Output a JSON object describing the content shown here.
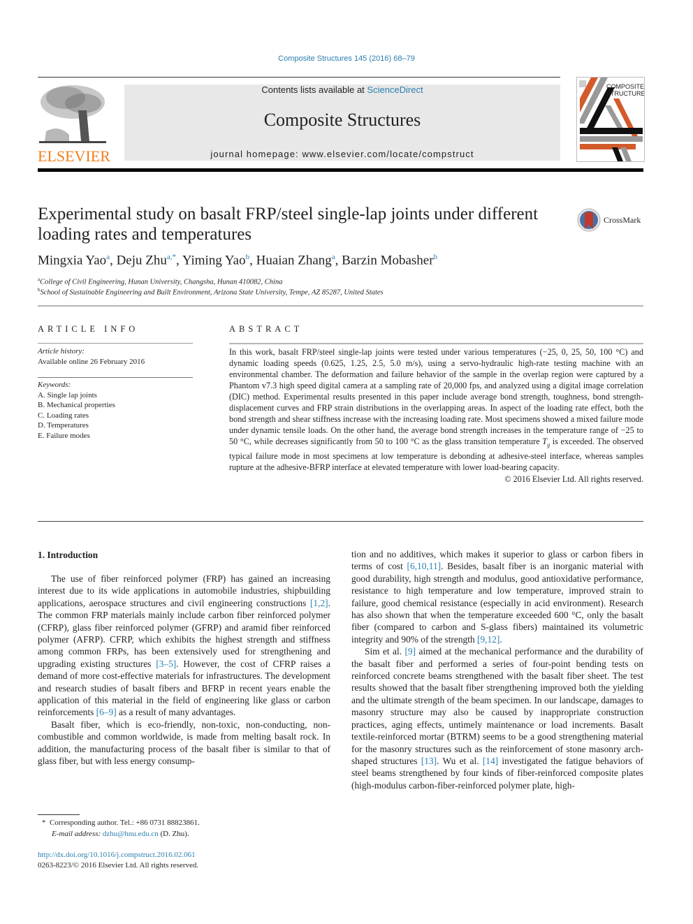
{
  "header": {
    "citation": "Composite Structures 145 (2016) 68–79",
    "contents_prefix": "Contents lists available at ",
    "contents_link": "ScienceDirect",
    "journal_name": "Composite Structures",
    "homepage": "journal homepage: www.elsevier.com/locate/compstruct",
    "publisher_logo_text": "ELSEVIER",
    "cover_text_line1": "COMPOSITE",
    "cover_text_line2": "STRUCTURES",
    "crossmark_label": "CrossMark"
  },
  "colors": {
    "link": "#2a7fb0",
    "elsevier_orange": "#f07f1c",
    "cover_orange": "#d35a2a",
    "crossmark_red": "#c0392b"
  },
  "article": {
    "title_line1": "Experimental study on basalt FRP/steel single-lap joints under different",
    "title_line2": "loading rates and temperatures",
    "authors": [
      {
        "name": "Mingxia Yao",
        "sup": "a"
      },
      {
        "name": "Deju Zhu",
        "sup": "a,*"
      },
      {
        "name": "Yiming Yao",
        "sup": "b"
      },
      {
        "name": "Huaian Zhang",
        "sup": "a"
      },
      {
        "name": "Barzin Mobasher",
        "sup": "b"
      }
    ],
    "affiliations": [
      {
        "sup": "a",
        "text": "College of Civil Engineering, Hunan University, Changsha, Hunan 410082, China"
      },
      {
        "sup": "b",
        "text": "School of Sustainable Engineering and Built Environment, Arizona State University, Tempe, AZ 85287, United States"
      }
    ]
  },
  "article_info": {
    "heading": "ARTICLE INFO",
    "history_label": "Article history:",
    "history_value": "Available online 26 February 2016",
    "keywords_label": "Keywords:",
    "keywords": [
      "A. Single lap joints",
      "B. Mechanical properties",
      "C. Loading rates",
      "D. Temperatures",
      "E. Failure modes"
    ]
  },
  "abstract": {
    "heading": "ABSTRACT",
    "text_part1": "In this work, basalt FRP/steel single-lap joints were tested under various temperatures (−25, 0, 25, 50, 100 °C) and dynamic loading speeds (0.625, 1.25, 2.5, 5.0 m/s), using a servo-hydraulic high-rate testing machine with an environmental chamber. The deformation and failure behavior of the sample in the overlap region were captured by a Phantom v7.3 high speed digital camera at a sampling rate of 20,000 fps, and analyzed using a digital image correlation (DIC) method. Experimental results presented in this paper include average bond strength, toughness, bond strength-displacement curves and FRP strain distributions in the overlapping areas. In aspect of the loading rate effect, both the bond strength and shear stiffness increase with the increasing loading rate. Most specimens showed a mixed failure mode under dynamic tensile loads. On the other hand, the average bond strength increases in the temperature range of −25 to 50 °C, while decreases significantly from 50 to 100 °C as the glass transition temperature ",
    "tg_symbol": "T",
    "tg_sub": "g",
    "text_part2": " is exceeded. The observed typical failure mode in most specimens at low temperature is debonding at adhesive-steel interface, whereas samples rupture at the adhesive-BFRP interface at elevated temperature with lower load-bearing capacity.",
    "copyright": "© 2016 Elsevier Ltd. All rights reserved."
  },
  "introduction": {
    "heading": "1. Introduction",
    "p1": [
      {
        "t": "The use of fiber reinforced polymer (FRP) has gained an increasing interest due to its wide applications in automobile industries, shipbuilding applications, aerospace structures and civil engineering constructions "
      },
      {
        "ref": "[1,2]"
      },
      {
        "t": ". The common FRP materials mainly include carbon fiber reinforced polymer (CFRP), glass fiber reinforced polymer (GFRP) and aramid fiber reinforced polymer (AFRP). CFRP, which exhibits the highest strength and stiffness among common FRPs, has been extensively used for strengthening and upgrading existing structures "
      },
      {
        "ref": "[3–5]"
      },
      {
        "t": ". However, the cost of CFRP raises a demand of more cost-effective materials for infrastructures. The development and research studies of basalt fibers and BFRP in recent years enable the application of this material in the field of engineering like glass or carbon reinforcements "
      },
      {
        "ref": "[6–9]"
      },
      {
        "t": " as a result of many advantages."
      }
    ],
    "p2": [
      {
        "t": "Basalt fiber, which is eco-friendly, non-toxic, non-conducting, non-combustible and common worldwide, is made from melting basalt rock. In addition, the manufacturing process of the basalt fiber is similar to that of glass fiber, but with less energy consump-"
      }
    ],
    "col2_p2_cont": [
      {
        "t": "tion and no additives, which makes it superior to glass or carbon fibers in terms of cost "
      },
      {
        "ref": "[6,10,11]"
      },
      {
        "t": ". Besides, basalt fiber is an inorganic material with good durability, high strength and modulus, good antioxidative performance, resistance to high temperature and low temperature, improved strain to failure, good chemical resistance (especially in acid environment). Research has also shown that when the temperature exceeded 600 °C, only the basalt fiber (compared to carbon and S-glass fibers) maintained its volumetric integrity and 90% of the strength "
      },
      {
        "ref": "[9,12]"
      },
      {
        "t": "."
      }
    ],
    "p3": [
      {
        "t": "Sim et al. "
      },
      {
        "ref": "[9]"
      },
      {
        "t": " aimed at the mechanical performance and the durability of the basalt fiber and performed a series of four-point bending tests on reinforced concrete beams strengthened with the basalt fiber sheet. The test results showed that the basalt fiber strengthening improved both the yielding and the ultimate strength of the beam specimen. In our landscape, damages to masonry structure may also be caused by inappropriate construction practices, aging effects, untimely maintenance or load increments. Basalt textile-reinforced mortar (BTRM) seems to be a good strengthening material for the masonry structures such as the reinforcement of stone masonry arch-shaped structures "
      },
      {
        "ref": "[13]"
      },
      {
        "t": ". Wu et al. "
      },
      {
        "ref": "[14]"
      },
      {
        "t": " investigated the fatigue behaviors of steel beams strengthened by four kinds of fiber-reinforced composite plates (high-modulus carbon-fiber-reinforced polymer plate, high-"
      }
    ]
  },
  "footnotes": {
    "corresponding": "Corresponding author. Tel.: +86 0731 88823861.",
    "corresponding_mark": "*",
    "email_label": "E-mail address:",
    "email": "dzhu@hnu.edu.cn",
    "email_suffix": " (D. Zhu).",
    "doi": "http://dx.doi.org/10.1016/j.compstruct.2016.02.061",
    "issn": "0263-8223/© 2016 Elsevier Ltd. All rights reserved."
  }
}
